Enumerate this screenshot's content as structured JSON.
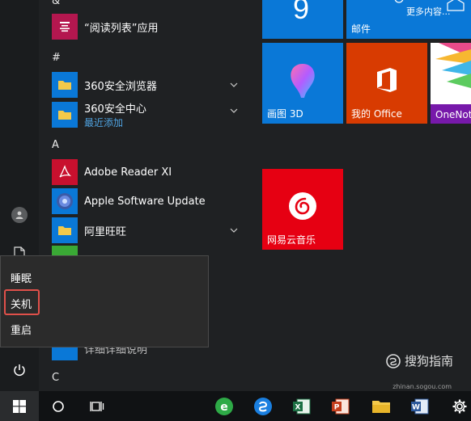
{
  "letters": {
    "amp": "&",
    "hash": "#",
    "a": "A",
    "c": "C"
  },
  "apps": {
    "reading_list": "“阅读列表”应用",
    "browser_360": "360安全浏览器",
    "center_360": "360安全中心",
    "center_360_sub": "最近添加",
    "adobe": "Adobe Reader XI",
    "apple_update": "Apple Software Update",
    "aliwangwang": "阿里旺旺",
    "partial_bottom": "详细详细说明"
  },
  "tiles": {
    "calendar_number": "9",
    "mail_more": "更多内容...",
    "mail": "邮件",
    "paint3d": "画图 3D",
    "office": "我的 Office",
    "onenote": "OneNote",
    "netease": "网易云音乐"
  },
  "power_menu": {
    "sleep": "睡眠",
    "shutdown": "关机",
    "restart": "重启"
  },
  "watermark": {
    "main": "搜狗指南",
    "sub": "zhinan.sogou.com"
  },
  "colors": {
    "tile_blue": "#0a78d7",
    "office_orange": "#d83b01",
    "netease_red": "#e60012",
    "highlight_red": "#e0504a"
  }
}
